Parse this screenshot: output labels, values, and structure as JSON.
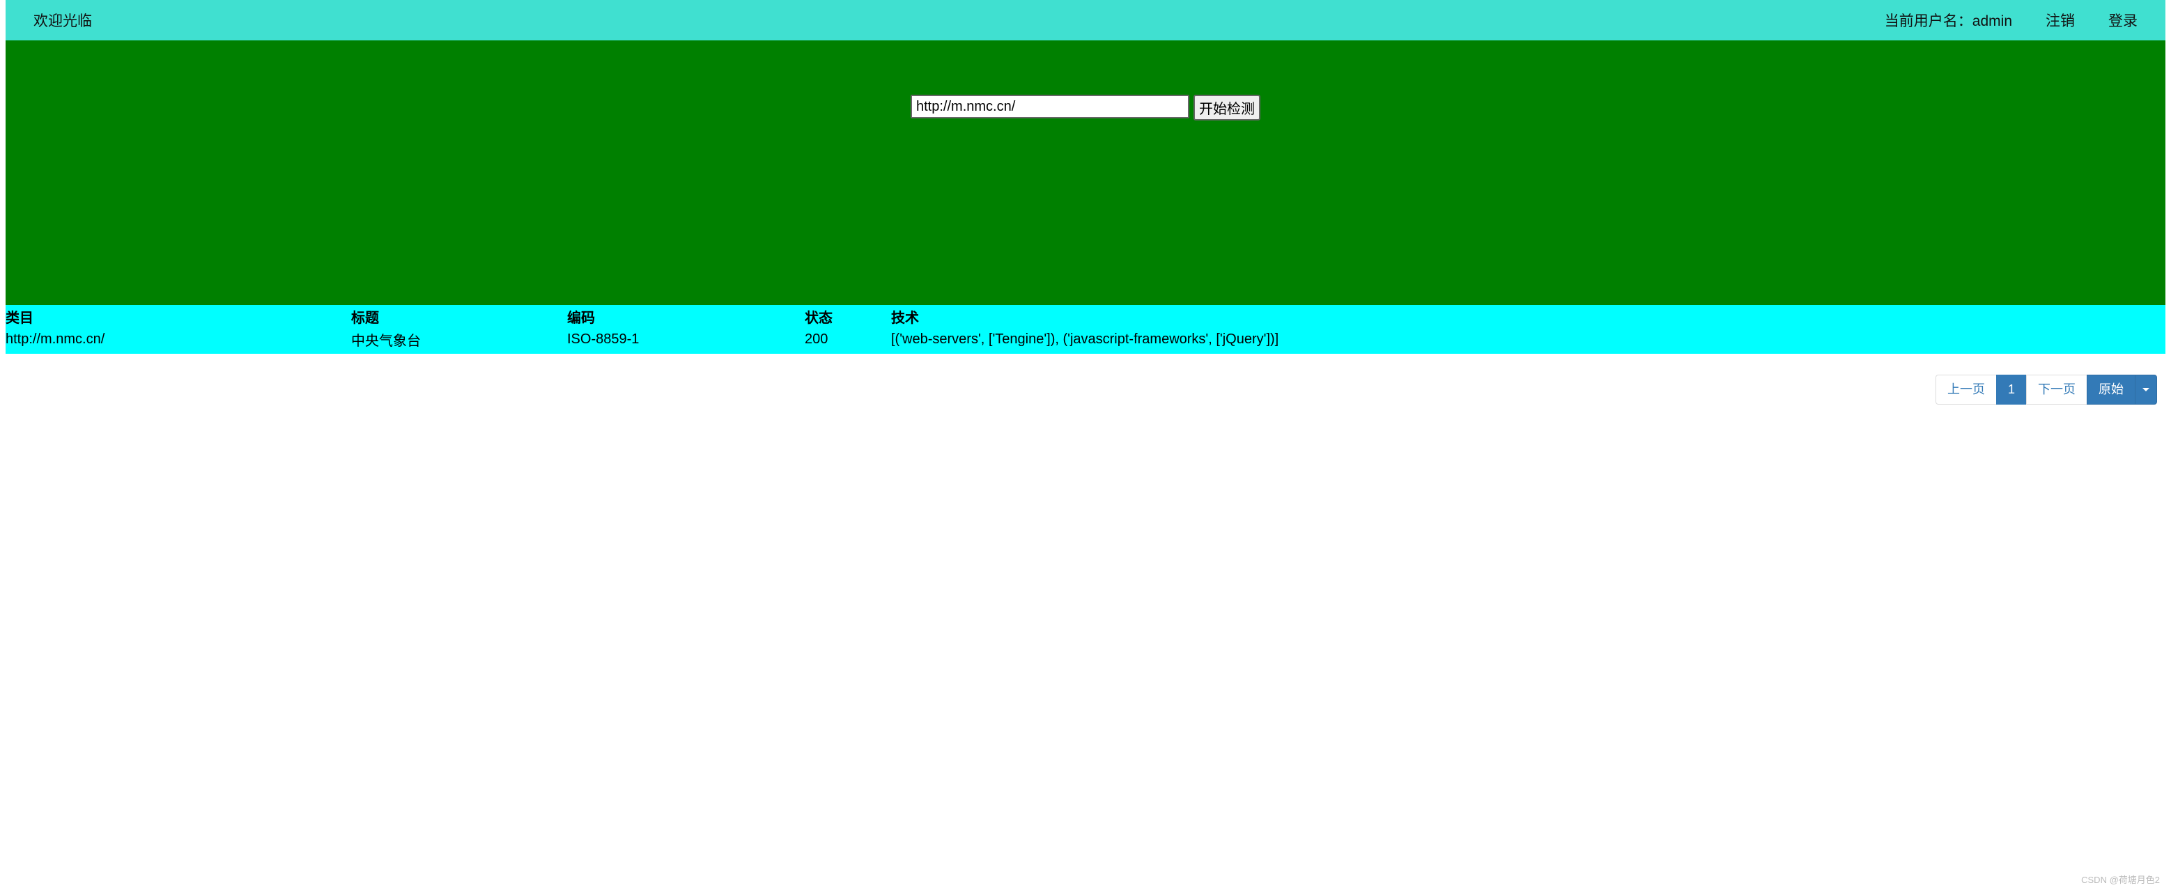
{
  "topbar": {
    "welcome": "欢迎光临",
    "current_user_label": "当前用户名：admin",
    "logout": "注销",
    "login": "登录"
  },
  "search": {
    "value": "http://m.nmc.cn/",
    "button": "开始检测"
  },
  "table": {
    "headers": {
      "category": "类目",
      "title": "标题",
      "encoding": "编码",
      "status": "状态",
      "tech": "技术"
    },
    "row": {
      "category": "http://m.nmc.cn/",
      "title": "中央气象台",
      "encoding": "ISO-8859-1",
      "status": "200",
      "tech": "[('web-servers', ['Tengine']), ('javascript-frameworks', ['jQuery'])]"
    }
  },
  "pagination": {
    "prev": "上一页",
    "page1": "1",
    "next": "下一页",
    "raw": "原始"
  },
  "watermark": "CSDN @荷塘月色2"
}
